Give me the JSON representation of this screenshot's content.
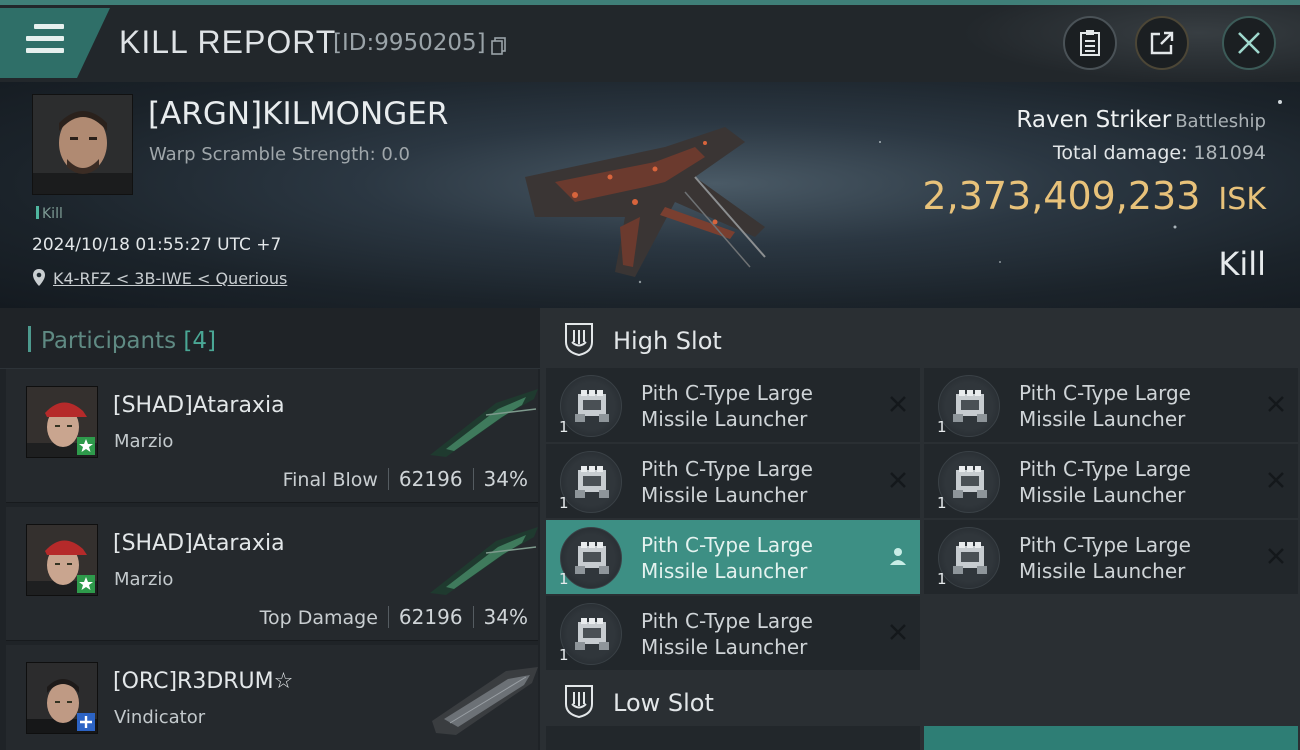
{
  "header": {
    "title": "KILL REPORT",
    "report_id": "[ID:9950205]",
    "icons": [
      "menu-icon",
      "copy-icon",
      "clipboard-icon",
      "share-icon",
      "close-icon"
    ]
  },
  "victim": {
    "name": "[ARGN]KILMONGER",
    "warp_scramble": "Warp Scramble Strength: 0.0",
    "tag": "Kill",
    "timestamp": "2024/10/18 01:55:27 UTC +7",
    "location": "K4-RFZ < 3B-IWE < Querious",
    "ship_name": "Raven Striker",
    "ship_class": "Battleship",
    "total_damage_label": "Total damage:",
    "total_damage": "181094",
    "isk_value": "2,373,409,233",
    "isk_unit": "ISK",
    "result": "Kill"
  },
  "participants": {
    "label": "Participants",
    "count": "[4]",
    "rows": [
      {
        "name": "[SHAD]Ataraxia",
        "ship": "Marzio",
        "stat_label": "Final Blow",
        "damage": "62196",
        "percent": "34%"
      },
      {
        "name": "[SHAD]Ataraxia",
        "ship": "Marzio",
        "stat_label": "Top Damage",
        "damage": "62196",
        "percent": "34%"
      },
      {
        "name": "[ORC]R3DRUM☆",
        "ship": "Vindicator",
        "stat_label": "",
        "damage": "",
        "percent": ""
      }
    ]
  },
  "fitting": {
    "high_slot_label": "High Slot",
    "low_slot_label": "Low Slot",
    "high_modules": [
      {
        "line1": "Pith C-Type Large",
        "line2": "Missile Launcher",
        "qty": "1",
        "status": "destroyed"
      },
      {
        "line1": "Pith C-Type Large",
        "line2": "Missile Launcher",
        "qty": "1",
        "status": "destroyed"
      },
      {
        "line1": "Pith C-Type Large",
        "line2": "Missile Launcher",
        "qty": "1",
        "status": "destroyed"
      },
      {
        "line1": "Pith C-Type Large",
        "line2": "Missile Launcher",
        "qty": "1",
        "status": "destroyed"
      },
      {
        "line1": "Pith C-Type Large",
        "line2": "Missile Launcher",
        "qty": "1",
        "status": "dropped"
      },
      {
        "line1": "Pith C-Type Large",
        "line2": "Missile Launcher",
        "qty": "1",
        "status": "destroyed"
      },
      {
        "line1": "Pith C-Type Large",
        "line2": "Missile Launcher",
        "qty": "1",
        "status": "destroyed"
      }
    ]
  },
  "colors": {
    "accent_teal": "#3d8f84",
    "isk_gold": "#e8c27a",
    "background": "#1a1d20"
  }
}
